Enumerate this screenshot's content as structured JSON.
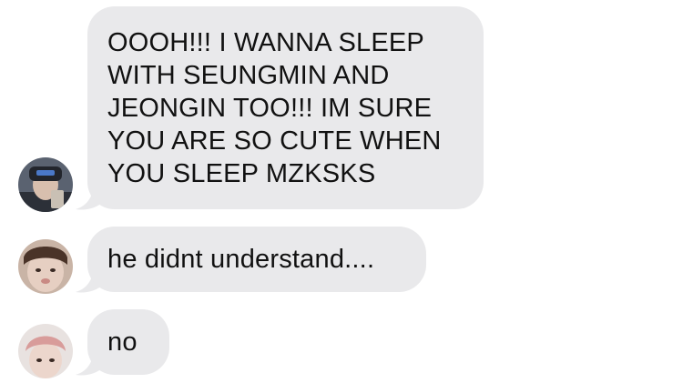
{
  "messages": [
    {
      "text": "OOOH!!! I WANNA SLEEP\nWITH SEUNGMIN AND\nJEONGIN TOO!!! IM SURE\nYOU ARE SO CUTE WHEN\nYOU SLEEP MZKSKS",
      "avatar_icon": "profile-photo-icon"
    },
    {
      "text": "he didnt understand....",
      "avatar_icon": "profile-photo-icon"
    },
    {
      "text": "no",
      "avatar_icon": "profile-photo-icon"
    }
  ],
  "colors": {
    "background": "#ffffff",
    "bubble": "#e9e9eb",
    "text": "#111111"
  }
}
